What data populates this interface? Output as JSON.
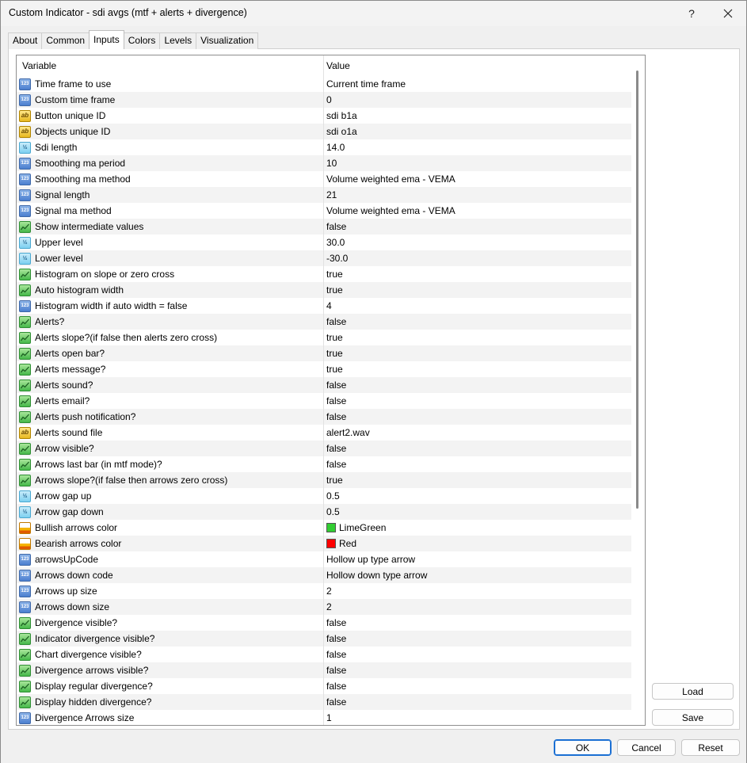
{
  "window": {
    "title": "Custom Indicator - sdi avgs (mtf + alerts + divergence)",
    "help_label": "?"
  },
  "tabs": [
    "About",
    "Common",
    "Inputs",
    "Colors",
    "Levels",
    "Visualization"
  ],
  "active_tab": "Inputs",
  "grid": {
    "headers": {
      "variable": "Variable",
      "value": "Value"
    },
    "rows": [
      {
        "type": "int",
        "icon": "int-type-icon",
        "name": "Time frame to use",
        "value": "Current time frame"
      },
      {
        "type": "int",
        "icon": "int-type-icon",
        "name": "Custom time frame",
        "value": "0"
      },
      {
        "type": "str",
        "icon": "string-type-icon",
        "name": "Button unique ID",
        "value": "sdi b1a"
      },
      {
        "type": "str",
        "icon": "string-type-icon",
        "name": "Objects unique ID",
        "value": "sdi o1a"
      },
      {
        "type": "dbl",
        "icon": "double-type-icon",
        "name": "Sdi length",
        "value": "14.0"
      },
      {
        "type": "int",
        "icon": "int-type-icon",
        "name": "Smoothing ma period",
        "value": "10"
      },
      {
        "type": "int",
        "icon": "int-type-icon",
        "name": "Smoothing ma method",
        "value": "Volume weighted ema - VEMA"
      },
      {
        "type": "int",
        "icon": "int-type-icon",
        "name": "Signal length",
        "value": "21"
      },
      {
        "type": "int",
        "icon": "int-type-icon",
        "name": "Signal ma method",
        "value": "Volume weighted ema - VEMA"
      },
      {
        "type": "bool",
        "icon": "bool-type-icon",
        "name": "Show intermediate values",
        "value": "false"
      },
      {
        "type": "dbl",
        "icon": "double-type-icon",
        "name": "Upper level",
        "value": "30.0"
      },
      {
        "type": "dbl",
        "icon": "double-type-icon",
        "name": "Lower level",
        "value": "-30.0"
      },
      {
        "type": "bool",
        "icon": "bool-type-icon",
        "name": "Histogram on slope or zero cross",
        "value": "true"
      },
      {
        "type": "bool",
        "icon": "bool-type-icon",
        "name": "Auto histogram width",
        "value": "true"
      },
      {
        "type": "int",
        "icon": "int-type-icon",
        "name": "Histogram width if auto width = false",
        "value": "4"
      },
      {
        "type": "bool",
        "icon": "bool-type-icon",
        "name": "Alerts?",
        "value": "false"
      },
      {
        "type": "bool",
        "icon": "bool-type-icon",
        "name": "Alerts slope?(if false then alerts zero cross)",
        "value": "true"
      },
      {
        "type": "bool",
        "icon": "bool-type-icon",
        "name": "Alerts open bar?",
        "value": "true"
      },
      {
        "type": "bool",
        "icon": "bool-type-icon",
        "name": "Alerts message?",
        "value": "true"
      },
      {
        "type": "bool",
        "icon": "bool-type-icon",
        "name": "Alerts sound?",
        "value": "false"
      },
      {
        "type": "bool",
        "icon": "bool-type-icon",
        "name": "Alerts email?",
        "value": "false"
      },
      {
        "type": "bool",
        "icon": "bool-type-icon",
        "name": "Alerts push notification?",
        "value": "false"
      },
      {
        "type": "str",
        "icon": "string-type-icon",
        "name": "Alerts sound file",
        "value": "alert2.wav"
      },
      {
        "type": "bool",
        "icon": "bool-type-icon",
        "name": "Arrow visible?",
        "value": "false"
      },
      {
        "type": "bool",
        "icon": "bool-type-icon",
        "name": "Arrows last bar (in mtf mode)?",
        "value": "false"
      },
      {
        "type": "bool",
        "icon": "bool-type-icon",
        "name": "Arrows slope?(if false then arrows zero cross)",
        "value": "true"
      },
      {
        "type": "dbl",
        "icon": "double-type-icon",
        "name": "Arrow gap up",
        "value": "0.5"
      },
      {
        "type": "dbl",
        "icon": "double-type-icon",
        "name": "Arrow gap down",
        "value": "0.5"
      },
      {
        "type": "color",
        "icon": "color-type-icon",
        "name": "Bullish arrows color",
        "value": "LimeGreen",
        "swatch": "#32cd32"
      },
      {
        "type": "color",
        "icon": "color-type-icon",
        "name": "Bearish arrows color",
        "value": "Red",
        "swatch": "#ff0000"
      },
      {
        "type": "int",
        "icon": "int-type-icon",
        "name": "arrowsUpCode",
        "value": "Hollow up type arrow"
      },
      {
        "type": "int",
        "icon": "int-type-icon",
        "name": "Arrows down code",
        "value": "Hollow down type arrow"
      },
      {
        "type": "int",
        "icon": "int-type-icon",
        "name": "Arrows up size",
        "value": "2"
      },
      {
        "type": "int",
        "icon": "int-type-icon",
        "name": "Arrows down size",
        "value": "2"
      },
      {
        "type": "bool",
        "icon": "bool-type-icon",
        "name": "Divergence visible?",
        "value": "false"
      },
      {
        "type": "bool",
        "icon": "bool-type-icon",
        "name": "Indicator divergence visible?",
        "value": "false"
      },
      {
        "type": "bool",
        "icon": "bool-type-icon",
        "name": "Chart divergence visible?",
        "value": "false"
      },
      {
        "type": "bool",
        "icon": "bool-type-icon",
        "name": "Divergence arrows visible?",
        "value": "false"
      },
      {
        "type": "bool",
        "icon": "bool-type-icon",
        "name": "Display regular divergence?",
        "value": "false"
      },
      {
        "type": "bool",
        "icon": "bool-type-icon",
        "name": "Display hidden divergence?",
        "value": "false"
      },
      {
        "type": "int",
        "icon": "int-type-icon",
        "name": "Divergence Arrows size",
        "value": "1"
      }
    ]
  },
  "icon_glyphs": {
    "int": "123",
    "str": "ab",
    "dbl": "½"
  },
  "buttons": {
    "load": "Load",
    "save": "Save",
    "ok": "OK",
    "cancel": "Cancel",
    "reset": "Reset"
  },
  "colors": {
    "accent": "#1a6fd3"
  }
}
